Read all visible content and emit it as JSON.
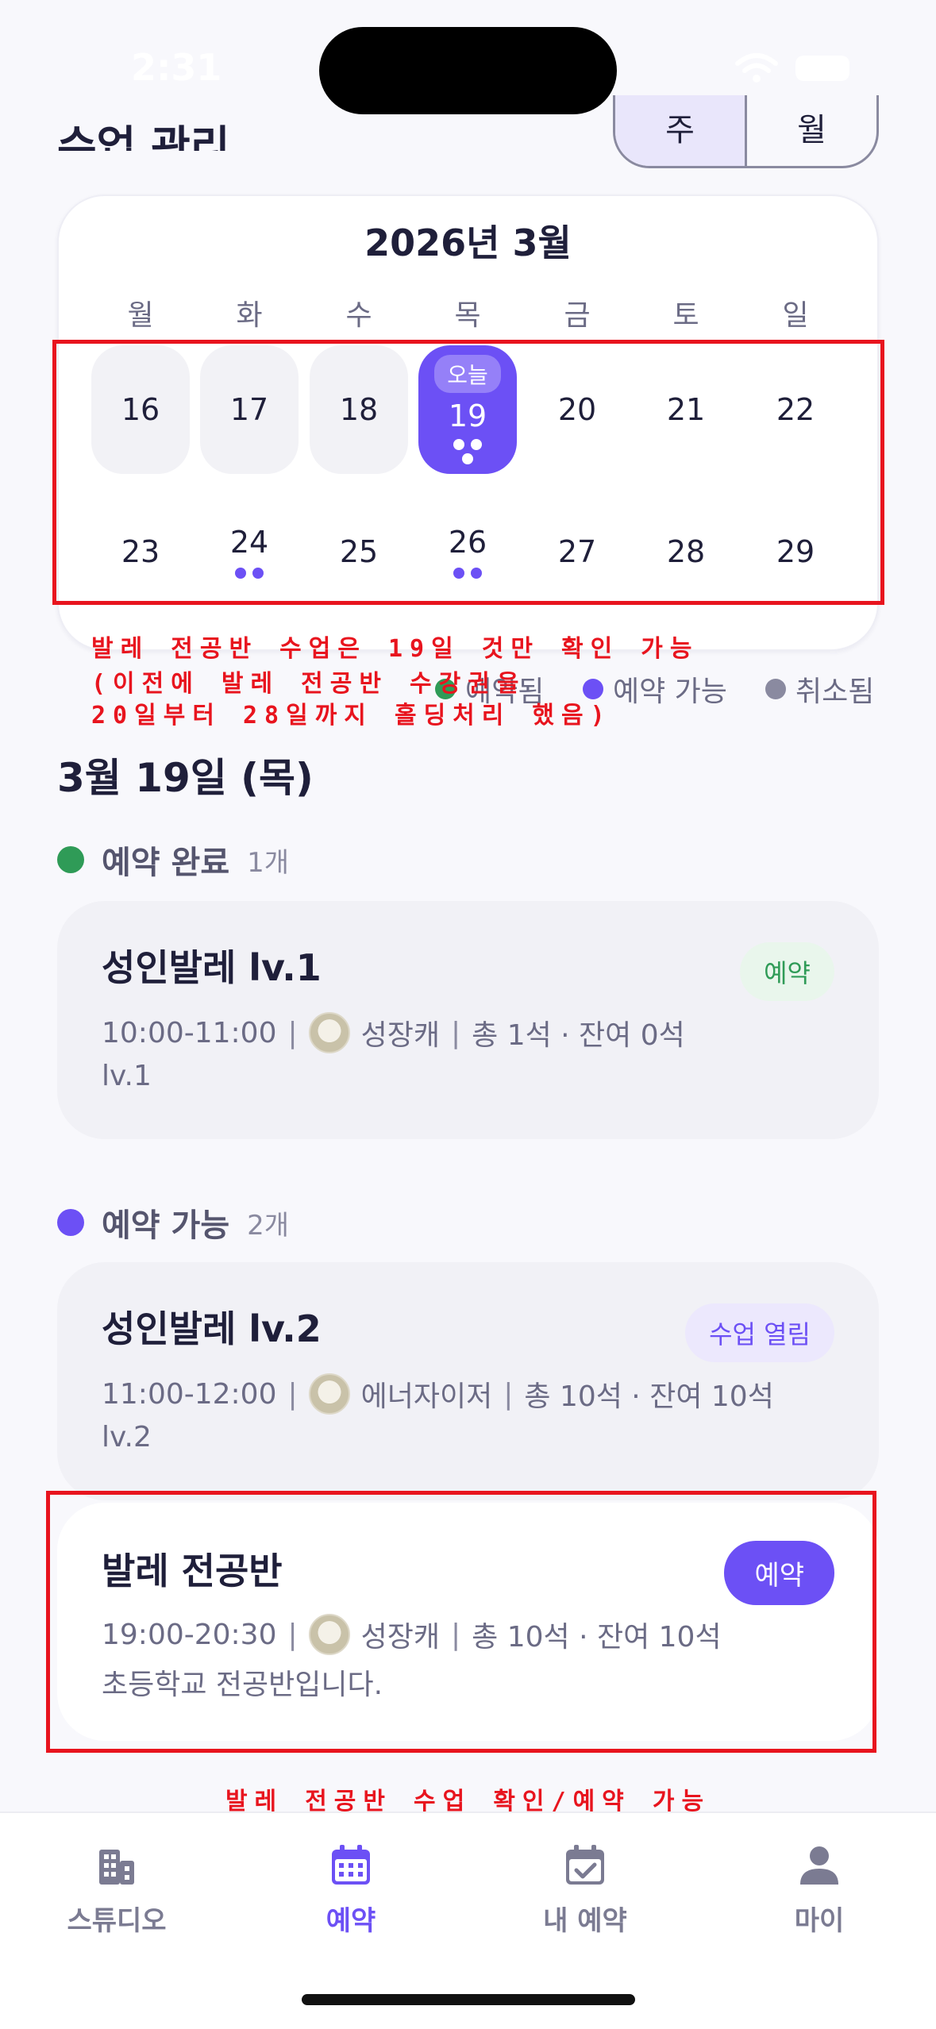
{
  "status": {
    "time": "2:31"
  },
  "header": {
    "title": "수업 관리",
    "toggle": [
      "주",
      "월"
    ]
  },
  "calendar": {
    "title": "2026년 3월",
    "weekdays": [
      "월",
      "화",
      "수",
      "목",
      "금",
      "토",
      "일"
    ],
    "week1": [
      "16",
      "17",
      "18",
      "19",
      "20",
      "21",
      "22"
    ],
    "week2": [
      "23",
      "24",
      "25",
      "26",
      "27",
      "28",
      "29"
    ],
    "today_label": "오늘"
  },
  "legend": {
    "reserved": "예약됨",
    "available": "예약 가능",
    "cancelled": "취소됨"
  },
  "annotations": {
    "top_line1": "발레 전공반 수업은 19일 것만 확인 가능",
    "top_line2": "(이전에 발레 전공반 수강권을",
    "top_line3": "20일부터 28일까지 홀딩처리 했음)",
    "bottom": "발레 전공반 수업 확인/예약 가능"
  },
  "selected_date": "3월 19일 (목)",
  "sections": {
    "done": {
      "title": "예약 완료",
      "count": "1개"
    },
    "available": {
      "title": "예약 가능",
      "count": "2개"
    }
  },
  "classes": [
    {
      "title": "성인발레 lv.1",
      "time": "10:00-11:00",
      "teacher": "성장캐",
      "seats": "총 1석 · 잔여 0석",
      "desc": "lv.1",
      "badge": "예약"
    },
    {
      "title": "성인발레 lv.2",
      "time": "11:00-12:00",
      "teacher": "에너자이저",
      "seats": "총 10석 · 잔여 10석",
      "desc": "lv.2",
      "badge": "수업 열림"
    },
    {
      "title": "발레 전공반",
      "time": "19:00-20:30",
      "teacher": "성장캐",
      "seats": "총 10석 · 잔여 10석",
      "desc": "초등학교 전공반입니다.",
      "badge": "예약"
    }
  ],
  "tabs": [
    {
      "label": "스튜디오",
      "icon": "building-icon"
    },
    {
      "label": "예약",
      "icon": "calendar-icon"
    },
    {
      "label": "내 예약",
      "icon": "calendar-check-icon"
    },
    {
      "label": "마이",
      "icon": "person-icon"
    }
  ],
  "colors": {
    "accent": "#6c50f5",
    "green": "#2f9b57",
    "annotation": "#e8141e",
    "gray": "#8a8aa0"
  }
}
